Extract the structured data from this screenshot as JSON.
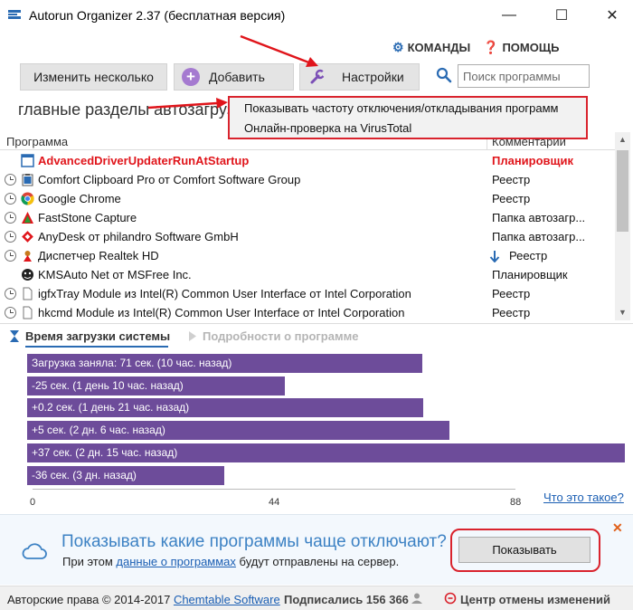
{
  "window": {
    "title": "Autorun Organizer 2.37 (бесплатная версия)",
    "minimize_glyph": "—",
    "maximize_glyph": "☐",
    "close_glyph": "✕"
  },
  "top_menu": {
    "commands_label": "КОМАНДЫ",
    "help_label": "ПОМОЩЬ"
  },
  "toolbar": {
    "edit_multiple_label": "Изменить несколько",
    "add_label": "Добавить",
    "settings_label": "Настройки",
    "search_placeholder": "Поиск программы"
  },
  "section_title": "главные разделы автозагрузки",
  "settings_menu": {
    "items": [
      "Показывать частоту отключения/откладывания программ",
      "Онлайн-проверка на VirusTotal"
    ]
  },
  "table": {
    "headers": [
      "Программа",
      "Комментарии"
    ],
    "rows": [
      {
        "name": "AdvancedDriverUpdaterRunAtStartup",
        "comment": "Планировщик",
        "icon": "app-window-icon",
        "highlight": true
      },
      {
        "name": "Comfort Clipboard Pro от Comfort Software Group",
        "comment": "Реестр",
        "icon": "clipboard-icon"
      },
      {
        "name": "Google Chrome",
        "comment": "Реестр",
        "icon": "chrome-icon"
      },
      {
        "name": "FastStone Capture",
        "comment": "Папка автозагр...",
        "icon": "faststone-icon"
      },
      {
        "name": "AnyDesk от philandro Software GmbH",
        "comment": "Папка автозагр...",
        "icon": "anydesk-icon"
      },
      {
        "name": "Диспетчер Realtek HD",
        "comment": "Реестр",
        "icon": "realtek-icon",
        "delayed": true
      },
      {
        "name": "KMSAuto Net от MSFree Inc.",
        "comment": "Планировщик",
        "icon": "kmsauto-icon"
      },
      {
        "name": "igfxTray Module из Intel(R) Common User Interface от Intel Corporation",
        "comment": "Реестр",
        "icon": "generic-file-icon"
      },
      {
        "name": "hkcmd Module из Intel(R) Common User Interface от Intel Corporation",
        "comment": "Реестр",
        "icon": "generic-file-icon"
      }
    ]
  },
  "panel_tabs": {
    "boot_time": "Время загрузки системы",
    "program_details": "Подробности о программе"
  },
  "chart_data": {
    "type": "bar",
    "orientation": "horizontal",
    "categories": [
      "Загрузка заняла: 71 сек. (10 час. назад)",
      "-25 сек. (1 день 10 час. назад)",
      "+0.2 сек. (1 день 21 час. назад)",
      "+5 сек. (2 дн. 6 час. назад)",
      "+37 сек. (2 дн. 15 час. назад)",
      "-36 сек. (3 дн. назад)"
    ],
    "values": [
      71,
      46,
      71.2,
      76,
      108,
      35
    ],
    "xlim": [
      0,
      88
    ],
    "ticks": [
      "0",
      "44",
      "88"
    ],
    "bar_color": "#6d4c9a"
  },
  "what_is_link": "Что это такое?",
  "notification": {
    "question": "Показывать какие программы чаще отключают?",
    "sub_prefix": "При этом",
    "sub_link": "данные о программах",
    "sub_suffix": "будут отправлены на сервер.",
    "button_label": "Показывать",
    "close_glyph": "✕"
  },
  "status_bar": {
    "copyright": "Авторские права © 2014-2017",
    "company_link": "Chemtable Software",
    "subscribers": "Подписались 156 366",
    "undo_center": "Центр отмены изменений"
  },
  "colors": {
    "accent_blue": "#2a6bb3",
    "highlight_red": "#d9232d",
    "bar_purple": "#6d4c9a"
  }
}
